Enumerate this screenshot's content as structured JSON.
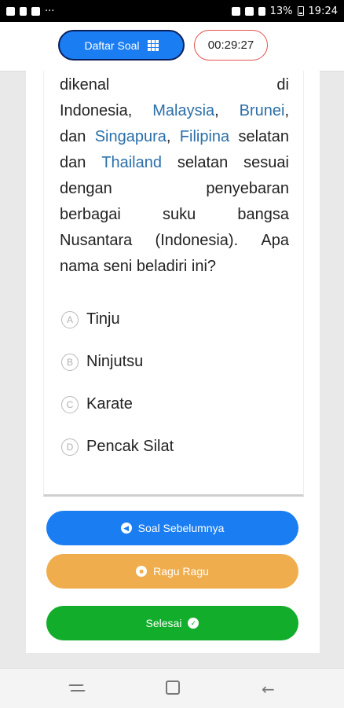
{
  "status_bar": {
    "battery": "13%",
    "time": "19:24"
  },
  "header": {
    "daftar_label": "Daftar Soal",
    "timer": "00:29:27"
  },
  "question": {
    "lines": [
      [
        "dikenal",
        "di"
      ],
      [
        "Indonesia,",
        "Malaysia,",
        "Brunei,"
      ],
      [
        "dan",
        "Singapura,",
        "Filipina",
        "selatan"
      ],
      [
        "dan",
        "Thailand",
        "selatan",
        "sesuai"
      ],
      [
        "dengan",
        "penyebaran"
      ],
      [
        "berbagai",
        "suku",
        "bangsa"
      ],
      [
        "Nusantara",
        "(Indonesia).",
        "Apa"
      ],
      [
        "nama seni beladiri ini?"
      ]
    ],
    "highlighted_words": [
      "Malaysia",
      "Brunei",
      "Singapura",
      "Filipina",
      "Thailand"
    ],
    "highlight_color": "#2b6fa8"
  },
  "options": [
    {
      "letter": "A",
      "text": "Tinju"
    },
    {
      "letter": "B",
      "text": "Ninjutsu"
    },
    {
      "letter": "C",
      "text": "Karate"
    },
    {
      "letter": "D",
      "text": "Pencak Silat"
    }
  ],
  "actions": {
    "prev_label": "Soal Sebelumnya",
    "ragu_label": "Ragu Ragu",
    "done_label": "Selesai"
  },
  "colors": {
    "primary": "#1a7df2",
    "warning": "#f0ad4e",
    "success": "#12ad2b"
  }
}
